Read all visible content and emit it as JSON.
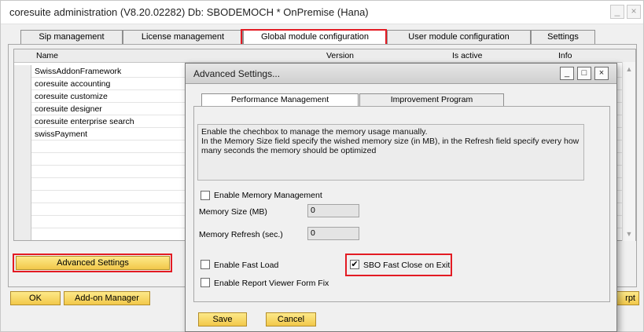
{
  "window": {
    "title": "coresuite administration (V8.20.02282) Db: SBODEMOCH * OnPremise (Hana)",
    "minimize_glyph": "_",
    "close_glyph": "×"
  },
  "tabs": [
    {
      "label": "Sip management"
    },
    {
      "label": "License management"
    },
    {
      "label": "Global module configuration"
    },
    {
      "label": "User module configuration"
    },
    {
      "label": "Settings"
    }
  ],
  "grid": {
    "columns": [
      "Name",
      "Version",
      "Is active",
      "Info"
    ],
    "rows": [
      {
        "name": "SwissAddonFramework"
      },
      {
        "name": "coresuite accounting"
      },
      {
        "name": "coresuite customize"
      },
      {
        "name": "coresuite designer"
      },
      {
        "name": "coresuite enterprise search"
      },
      {
        "name": "swissPayment"
      }
    ]
  },
  "buttons": {
    "advanced_settings": "Advanced Settings",
    "ok": "OK",
    "addon_manager": "Add-on Manager",
    "rpt_partial": "rpt"
  },
  "dialog": {
    "title": "Advanced Settings...",
    "minimize_glyph": "_",
    "maximize_glyph": "□",
    "close_glyph": "×",
    "tabs": [
      {
        "label": "Performance Management"
      },
      {
        "label": "Improvement Program"
      }
    ],
    "info_lines": [
      "Enable the chechbox to manage the memory usage manually.",
      "In the Memory Size field specify the wished memory size (in MB), in the Refresh field specify every how",
      "many seconds the memory should be optimized"
    ],
    "enable_memory_management": {
      "label": "Enable Memory Management",
      "checked": false
    },
    "memory_size": {
      "label": "Memory Size (MB)",
      "value": "0"
    },
    "memory_refresh": {
      "label": "Memory Refresh (sec.)",
      "value": "0"
    },
    "enable_fast_load": {
      "label": "Enable Fast Load",
      "checked": false
    },
    "sbo_fast_close": {
      "label": "SBO Fast Close on Exit",
      "checked": true,
      "check_glyph": "✔"
    },
    "report_viewer_fix": {
      "label": "Enable Report Viewer Form Fix",
      "checked": false
    },
    "save_label": "Save",
    "cancel_label": "Cancel"
  },
  "colors": {
    "highlight": "#e31b23",
    "gold_button_top": "#fde98a",
    "gold_button_bottom": "#f2c84a"
  }
}
